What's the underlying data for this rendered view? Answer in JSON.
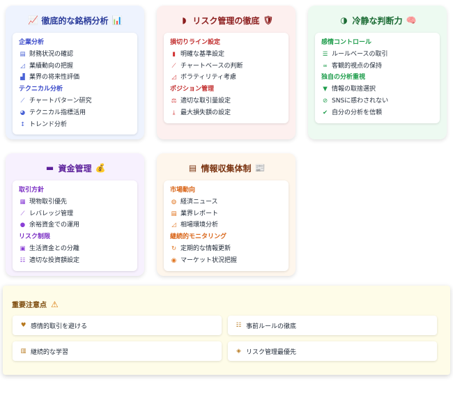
{
  "analysis": {
    "title": "徹底的な銘柄分析",
    "title_icon": "chart-line-icon",
    "title_emoji": "📊",
    "sections": [
      {
        "label": "企業分析",
        "items": [
          {
            "icon": "document-icon",
            "glyph": "▤",
            "label": "財務状況の確認"
          },
          {
            "icon": "area-chart-icon",
            "glyph": "◿",
            "label": "業績動向の把握"
          },
          {
            "icon": "industry-icon",
            "glyph": "▟",
            "label": "業界の将来性評価"
          }
        ]
      },
      {
        "label": "テクニカル分析",
        "items": [
          {
            "icon": "line-chart-icon",
            "glyph": "⟋",
            "label": "チャートパターン研究"
          },
          {
            "icon": "pie-chart-icon",
            "glyph": "◕",
            "label": "テクニカル指標活用"
          },
          {
            "icon": "arrows-vertical-icon",
            "glyph": "↕",
            "label": "トレンド分析"
          }
        ]
      }
    ]
  },
  "risk": {
    "title": "リスク管理の徹底",
    "title_icon": "shield-icon",
    "title_emoji": "🛡",
    "sections": [
      {
        "label": "損切りライン設定",
        "items": [
          {
            "icon": "ruler-icon",
            "glyph": "▮",
            "label": "明確な基準設定"
          },
          {
            "icon": "line-chart-icon",
            "glyph": "⟋",
            "label": "チャートベースの判断"
          },
          {
            "icon": "area-chart-icon",
            "glyph": "◿",
            "label": "ボラティリティ考慮"
          }
        ]
      },
      {
        "label": "ポジション管理",
        "items": [
          {
            "icon": "balance-scale-icon",
            "glyph": "⚖",
            "label": "適切な取引量設定"
          },
          {
            "icon": "level-down-icon",
            "glyph": "⤓",
            "label": "最大損失額の設定"
          }
        ]
      }
    ]
  },
  "calm": {
    "title": "冷静な判断力",
    "title_icon": "brain-icon",
    "title_emoji": "🧠",
    "sections": [
      {
        "label": "感情コントロール",
        "items": [
          {
            "icon": "list-icon",
            "glyph": "☰",
            "label": "ルールベースの取引"
          },
          {
            "icon": "glasses-icon",
            "glyph": "∞",
            "label": "客観的視点の保持"
          }
        ]
      },
      {
        "label": "独自の分析重視",
        "items": [
          {
            "icon": "filter-icon",
            "glyph": "▼",
            "label": "情報の取捨選択"
          },
          {
            "icon": "ban-icon",
            "glyph": "⊘",
            "label": "SNSに惑わされない"
          },
          {
            "icon": "check-circle-icon",
            "glyph": "✔",
            "label": "自分の分析を信頼"
          }
        ]
      }
    ]
  },
  "money": {
    "title": "資金管理",
    "title_icon": "wallet-icon",
    "title_emoji": "💰",
    "sections": [
      {
        "label": "取引方針",
        "items": [
          {
            "icon": "money-bills-icon",
            "glyph": "▦",
            "label": "現物取引優先"
          },
          {
            "icon": "line-chart-icon",
            "glyph": "⟋",
            "label": "レバレッジ管理"
          },
          {
            "icon": "piggy-bank-icon",
            "glyph": "●",
            "label": "余裕資金での運用"
          }
        ]
      },
      {
        "label": "リスク制限",
        "items": [
          {
            "icon": "lock-icon",
            "glyph": "▣",
            "label": "生活資金との分離"
          },
          {
            "icon": "sliders-icon",
            "glyph": "☷",
            "label": "適切な投資額設定"
          }
        ]
      }
    ]
  },
  "info": {
    "title": "情報収集体制",
    "title_icon": "newspaper-icon",
    "title_emoji": "📰",
    "sections": [
      {
        "label": "市場動向",
        "items": [
          {
            "icon": "globe-icon",
            "glyph": "◍",
            "label": "経済ニュース"
          },
          {
            "icon": "file-icon",
            "glyph": "▤",
            "label": "業界レポート"
          },
          {
            "icon": "area-chart-icon",
            "glyph": "◿",
            "label": "相場環境分析"
          }
        ]
      },
      {
        "label": "継続的モニタリング",
        "items": [
          {
            "icon": "sync-icon",
            "glyph": "↻",
            "label": "定期的な情報更新"
          },
          {
            "icon": "eye-icon",
            "glyph": "◉",
            "label": "マーケット状況把握"
          }
        ]
      }
    ]
  },
  "notes": {
    "title": "重要注意点",
    "title_emoji": "⚠",
    "items": [
      {
        "icon": "broken-heart-icon",
        "glyph": "♥",
        "label": "感情的取引を避ける"
      },
      {
        "icon": "list-ordered-icon",
        "glyph": "☷",
        "label": "事前ルールの徹底"
      },
      {
        "icon": "book-icon",
        "glyph": "▥",
        "label": "継続的な学習"
      },
      {
        "icon": "shield-halved-icon",
        "glyph": "◈",
        "label": "リスク管理最優先"
      }
    ]
  }
}
